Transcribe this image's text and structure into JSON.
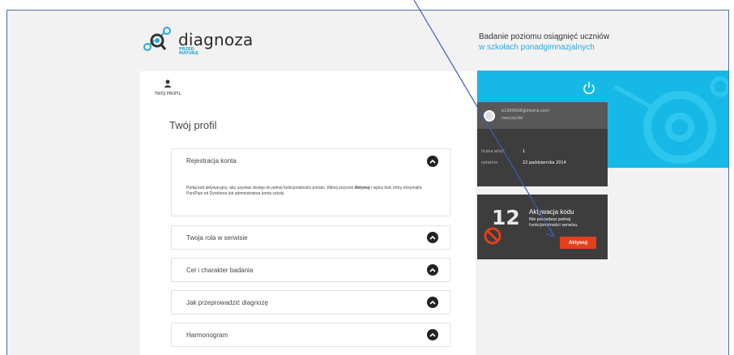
{
  "brand": {
    "name": "diagnoza",
    "sub_line1": "PRZED",
    "sub_line2": "MATURĄ"
  },
  "header": {
    "title": "Badanie poziomu osiągnięć uczniów",
    "subtitle": "w szkołach ponadgimnazjalnych"
  },
  "tab": {
    "label": "TWÓJ PROFIL"
  },
  "profile": {
    "title": "Twój profil"
  },
  "accordion": [
    {
      "label": "Rejestracja konta",
      "body_part1": "Podaj kod aktywacyjny, aby uzyskać dostęp do pełnej funkcjonalności portalu. Kliknij przycisk ",
      "body_bold": "Aktywuj",
      "body_part2": " i wpisz kod, który otrzymał/a Pan/Pani od Dyrektora lub administratora konta szkoły."
    },
    {
      "label": "Twoja rola w serwisie"
    },
    {
      "label": "Cel i charakter badania"
    },
    {
      "label": "Jak przeprowadzić diagnozę"
    },
    {
      "label": "Harmonogram"
    }
  ],
  "user": {
    "email": "b1005608@interia.com",
    "role": "nauczyciel",
    "visits_label": "liczba wizyt",
    "visits_value": "1",
    "last_label": "ostatnio",
    "last_value": "22 października 2014"
  },
  "activation": {
    "number": "12",
    "title": "Aktywacja kodu",
    "desc": "Nie posiadasz pełnej funkcjonalności serwisu.",
    "button": "Aktywuj"
  },
  "colors": {
    "accent_blue": "#16b9e6",
    "panel_dark": "#3d3d3d",
    "button_red": "#e2401c"
  }
}
